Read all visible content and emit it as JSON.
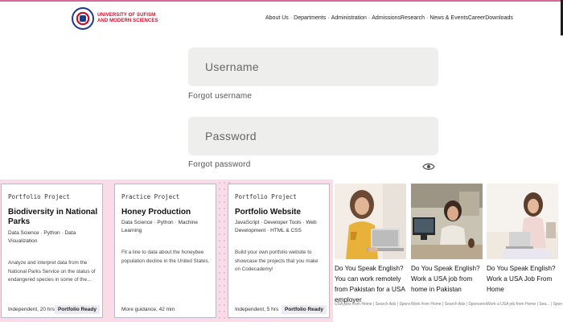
{
  "header": {
    "logo_line1": "UNIVERSITY OF SUFISM",
    "logo_line2": "AND MODERN SCIENCES",
    "nav": [
      "About Us",
      "·",
      "Departments",
      "·",
      "Administration",
      "·",
      "AdmissionsResearch",
      "·",
      "News & EventsCareerDownloads"
    ]
  },
  "login": {
    "username_placeholder": "Username",
    "forgot_username": "Forgot username",
    "password_placeholder": "Password",
    "forgot_password": "Forgot password"
  },
  "cards": [
    {
      "eyebrow": "Portfolio Project",
      "title": "Biodiversity in National Parks",
      "tags": "Data Science · Python · Data Visualization",
      "description": "Analyze and interpret data from the National Parks Service on the status of endangered species in some of the...",
      "meta": "Independent, 20 hrs",
      "badge": "Portfolio Ready"
    },
    {
      "eyebrow": "Practice Project",
      "title": "Honey Production",
      "tags": "Data Science · Python · Machine Learning",
      "description": "Fit a line to data about the honeybee population decline in the United States.",
      "meta": "More guidance, 42 min",
      "badge": ""
    },
    {
      "eyebrow": "Portfolio Project",
      "title": "Portfolio Website",
      "tags": "JavaScript · Developer Tools · Web Development · HTML & CSS",
      "description": "Build your own portfolio website to showcase the projects that you make on Codecademy!",
      "meta": "Independent, 5 hrs",
      "badge": "Portfolio Ready"
    }
  ],
  "ads": [
    {
      "title": "Do You Speak English? You can work remotely from Pakistan for a USA employer",
      "source": "USA jobs from Home | Search Ads | Sponsored"
    },
    {
      "title": "Do You Speak English? Work a USA job from home in Pakistan",
      "source": "Work from Home | Search Ads | Sponsored"
    },
    {
      "title": "Do You Speak English? Work a USA Job From Home",
      "source": "Work a USA job from Home | Sea... | Sponsored"
    }
  ]
}
